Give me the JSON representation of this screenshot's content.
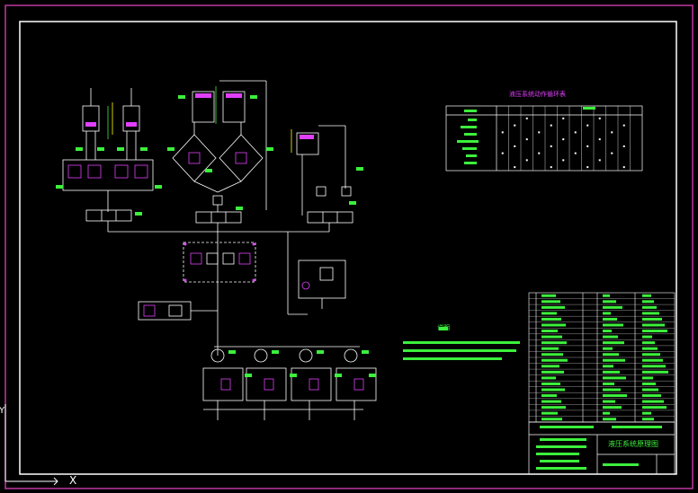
{
  "drawing": {
    "background": "#000000",
    "outer_border_color": "#c0389f",
    "inner_border_color": "#ffffff",
    "line_color": "#ffffff",
    "accent_magenta": "#e040fb",
    "accent_green": "#3cf03c",
    "accent_yellow": "#ffff00",
    "accent_cyan": "#00e5ff"
  },
  "upper_table": {
    "title": "液压系统动作循环表",
    "rows": 8,
    "cols": 12
  },
  "notes": {
    "heading": "说明",
    "lines": [
      "1.系统工作压力为...",
      "2.液压油采用...",
      "3.所有管路应..."
    ]
  },
  "title_block": {
    "drawing_title": "液压系统原理图",
    "parts_rows": 22
  },
  "ucs": {
    "x_label": "X",
    "y_label": "Y"
  },
  "callouts": [
    "①",
    "②",
    "③",
    "④",
    "⑤",
    "⑥",
    "⑦"
  ]
}
